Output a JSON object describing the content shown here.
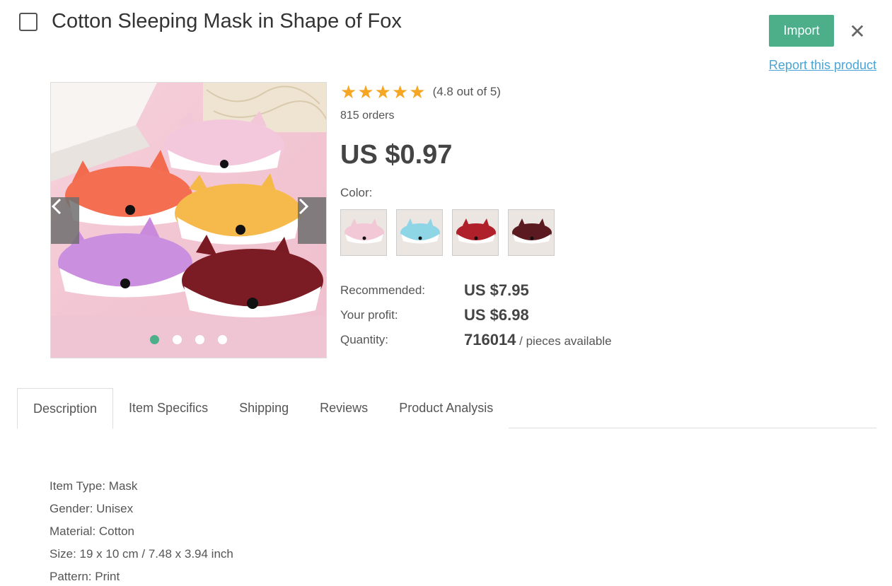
{
  "product": {
    "title": "Cotton Sleeping Mask in Shape of Fox",
    "rating_text": "(4.8 out of 5)",
    "rating_value": 4.8,
    "rating_max": 5,
    "orders": "815 orders",
    "price": "US $0.97",
    "color_label": "Color:"
  },
  "actions": {
    "import_label": "Import",
    "close_glyph": "✕",
    "report_label": "Report this product"
  },
  "gallery": {
    "image_count": 4,
    "active_index": 0
  },
  "swatches": [
    {
      "name": "pink",
      "color": "#f2c7d6"
    },
    {
      "name": "blue",
      "color": "#8ed6e6"
    },
    {
      "name": "red",
      "color": "#b0202a"
    },
    {
      "name": "brown",
      "color": "#5a1a1f"
    }
  ],
  "stats": {
    "recommended_label": "Recommended:",
    "recommended_value": "US $7.95",
    "profit_label": "Your profit:",
    "profit_value": "US $6.98",
    "quantity_label": "Quantity:",
    "quantity_value": "716014",
    "quantity_suffix": " / pieces available"
  },
  "tabs": [
    {
      "label": "Description",
      "active": true
    },
    {
      "label": "Item Specifics",
      "active": false
    },
    {
      "label": "Shipping",
      "active": false
    },
    {
      "label": "Reviews",
      "active": false
    },
    {
      "label": "Product Analysis",
      "active": false
    }
  ],
  "description": [
    "Item Type: Mask",
    "Gender: Unisex",
    "Material: Cotton",
    "Size: 19 x 10 cm / 7.48 x 3.94 inch",
    "Pattern: Print"
  ],
  "colors": {
    "accent": "#4caf8a",
    "link": "#4aa5d6",
    "star": "#f5a623"
  }
}
